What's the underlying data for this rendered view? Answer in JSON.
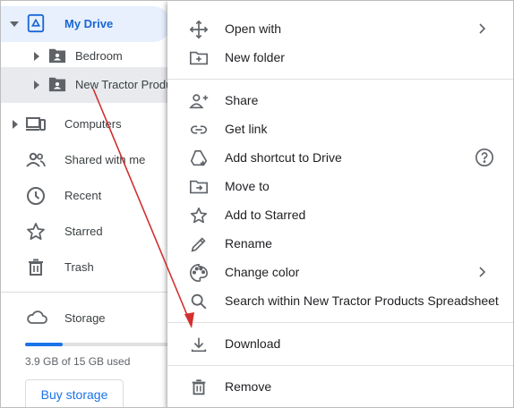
{
  "sidebar": {
    "my_drive": "My Drive",
    "folders": [
      {
        "label": "Bedroom"
      },
      {
        "label": "New Tractor Produ"
      }
    ],
    "computers": "Computers",
    "shared": "Shared with me",
    "recent": "Recent",
    "starred": "Starred",
    "trash": "Trash",
    "storage": {
      "label": "Storage",
      "used_text": "3.9 GB of 15 GB used",
      "used_fraction": 0.26,
      "buy": "Buy storage"
    }
  },
  "menu": {
    "open_with": "Open with",
    "new_folder": "New folder",
    "share": "Share",
    "get_link": "Get link",
    "add_shortcut": "Add shortcut to Drive",
    "move_to": "Move to",
    "add_starred": "Add to Starred",
    "rename": "Rename",
    "change_color": "Change color",
    "search_within": "Search within New Tractor Products Spreadsheet",
    "download": "Download",
    "remove": "Remove"
  },
  "colors": {
    "accent": "#1a73e8",
    "annotation_arrow": "#d32f2f"
  }
}
